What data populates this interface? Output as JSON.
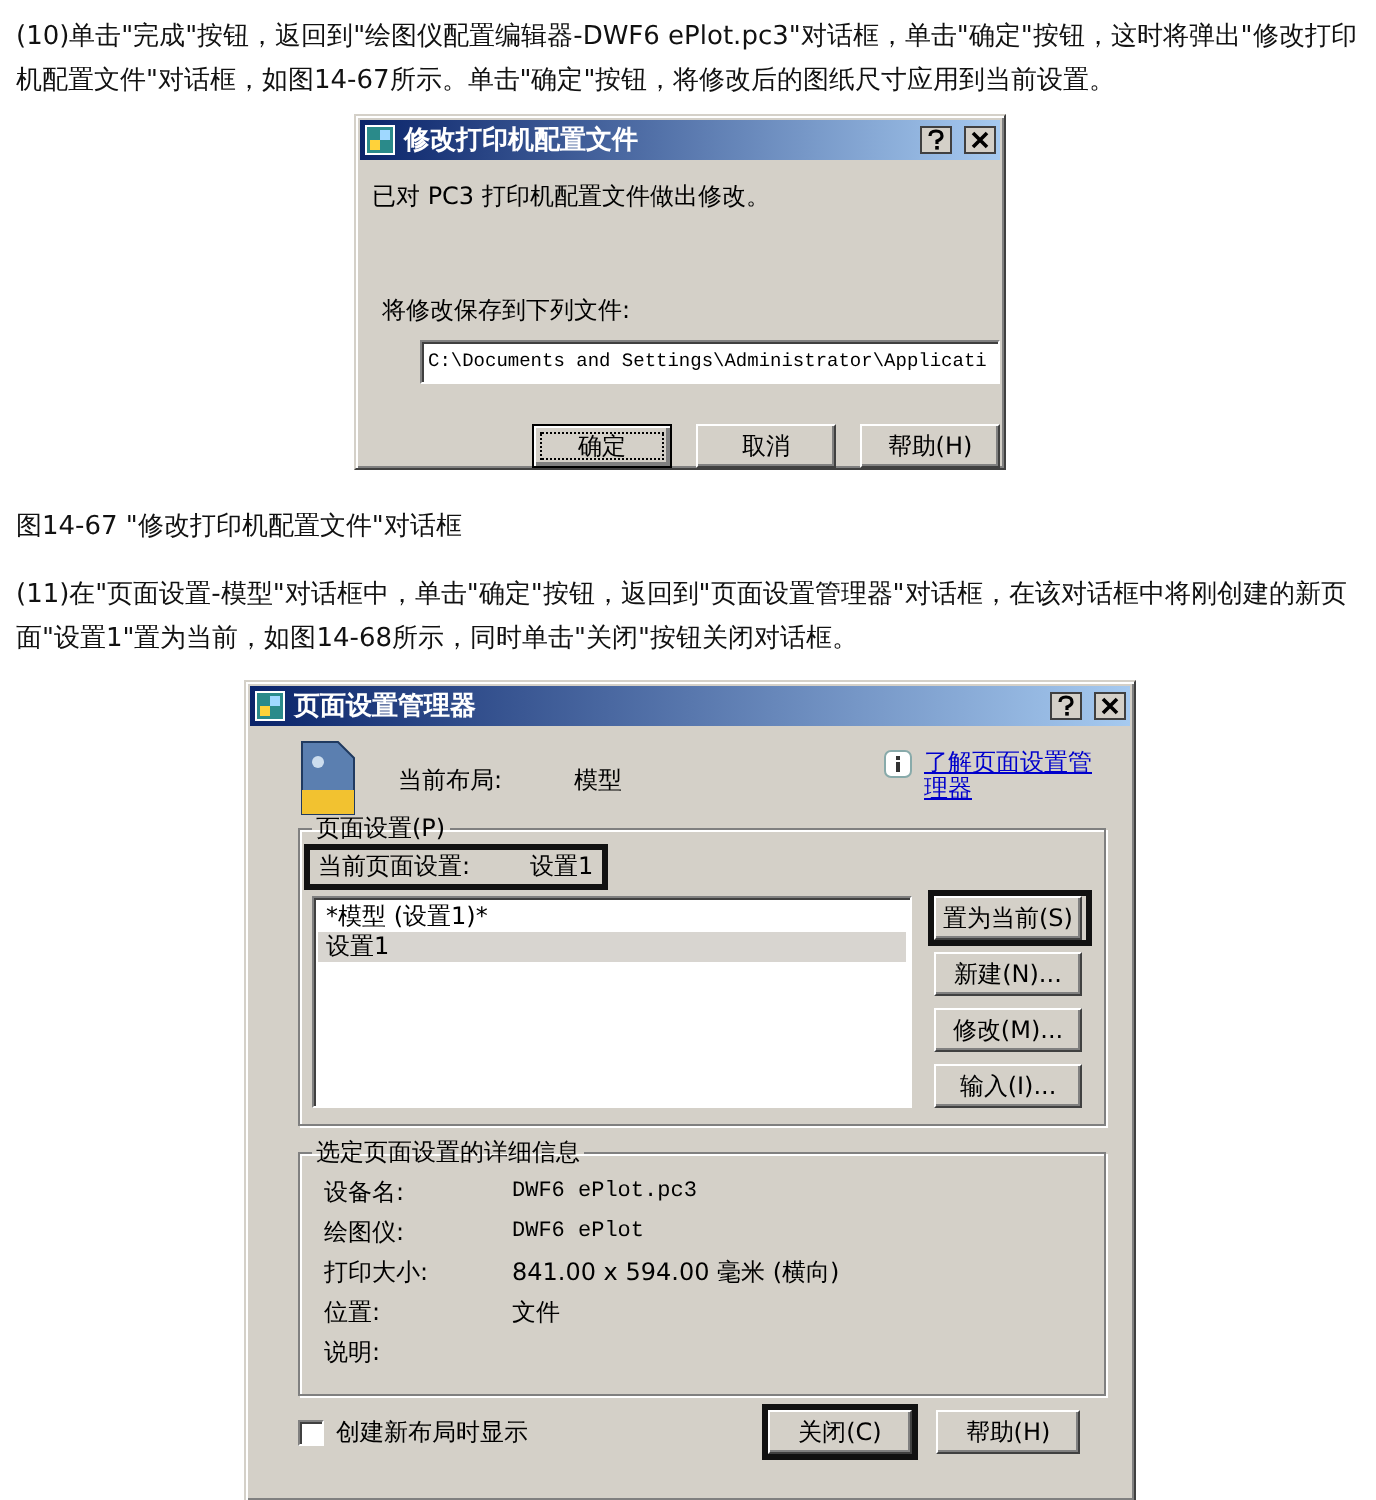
{
  "intro_paragraph": "(10)单击\"完成\"按钮，返回到\"绘图仪配置编辑器-DWF6 ePlot.pc3\"对话框，单击\"确定\"按钮，这时将弹出\"修改打印机配置文件\"对话框，如图14-67所示。单击\"确定\"按钮，将修改后的图纸尺寸应用到当前设置。",
  "figure_14_67": {
    "title": "修改打印机配置文件",
    "message": "已对 PC3 打印机配置文件做出修改。",
    "save_label": "将修改保存到下列文件:",
    "file_path": "C:\\Documents and Settings\\Administrator\\Applicati",
    "buttons": [
      {
        "label": "确定",
        "focused": true
      },
      {
        "label": "取消",
        "focused": false
      },
      {
        "label": "帮助(H)",
        "focused": false
      }
    ]
  },
  "caption_14_67": "图14-67 \"修改打印机配置文件\"对话框",
  "step_11_paragraph": "(11)在\"页面设置-模型\"对话框中，单击\"确定\"按钮，返回到\"页面设置管理器\"对话框，在该对话框中将刚创建的新页面\"设置1\"置为当前，如图14-68所示，同时单击\"关闭\"按钮关闭对话框。",
  "figure_14_68": {
    "title": "页面设置管理器",
    "current_layout": {
      "label": "当前布局:",
      "value": "模型"
    },
    "help_link": "了解页面设置管理器",
    "page_setups": {
      "title": "页面设置(P)",
      "current": {
        "label": "当前页面设置:",
        "value": "设置1",
        "highlighted": true
      },
      "items": [
        {
          "label": "*模型 (设置1)*",
          "selected": false
        },
        {
          "label": "设置1",
          "selected": true
        }
      ],
      "buttons": [
        {
          "label": "置为当前(S)",
          "highlighted": true
        },
        {
          "label": "新建(N)...",
          "highlighted": false
        },
        {
          "label": "修改(M)...",
          "highlighted": false
        },
        {
          "label": "输入(I)...",
          "highlighted": false
        }
      ]
    },
    "details": {
      "title": "选定页面设置的详细信息",
      "rows": [
        {
          "label": "设备名:",
          "value": "DWF6 ePlot.pc3"
        },
        {
          "label": "绘图仪:",
          "value": "DWF6 ePlot"
        },
        {
          "label": "打印大小:",
          "value": "841.00 x 594.00 毫米 (横向)"
        },
        {
          "label": "位置:",
          "value": "文件"
        },
        {
          "label": "说明:"
        }
      ]
    },
    "show_on_new_layout": {
      "label": "创建新布局时显示",
      "checked": false
    },
    "buttons": [
      {
        "label": "关闭(C)",
        "highlighted": true
      },
      {
        "label": "帮助(H)",
        "highlighted": false
      }
    ]
  }
}
